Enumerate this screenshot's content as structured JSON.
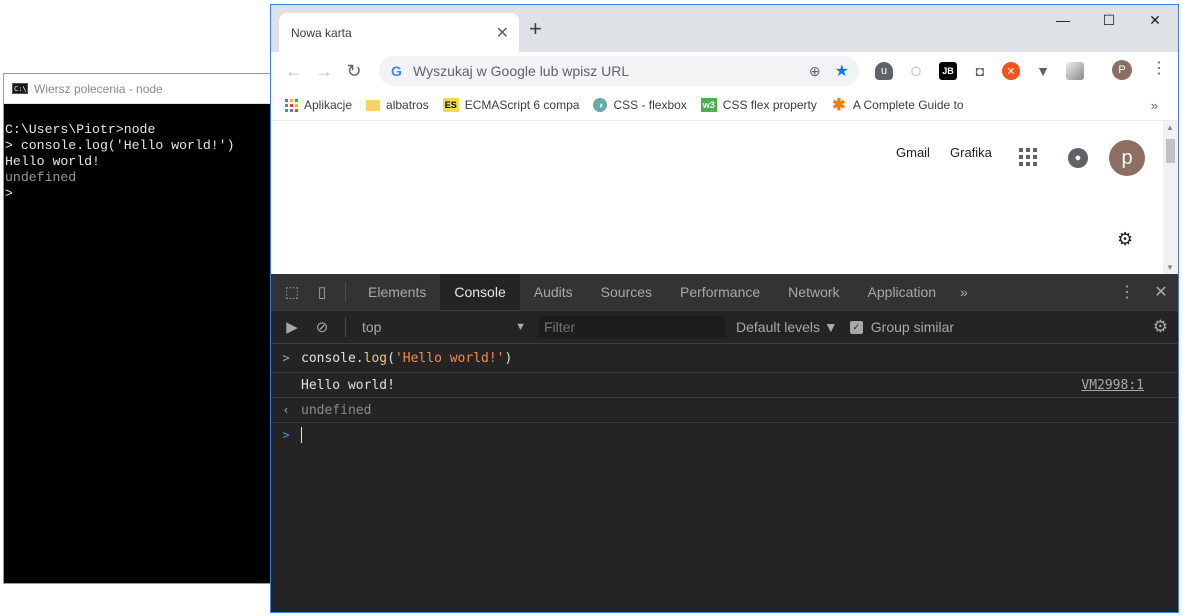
{
  "cmd": {
    "title": "Wiersz polecenia - node",
    "icon_label": "C:\\",
    "lines": [
      "C:\\Users\\Piotr>node",
      "> console.log('Hello world!')",
      "Hello world!",
      "undefined",
      ">"
    ]
  },
  "chrome": {
    "tab_title": "Nowa karta",
    "tab_close": "✕",
    "new_tab": "+",
    "window_controls": {
      "minimize": "—",
      "maximize": "☐",
      "close": "✕"
    },
    "nav": {
      "back": "←",
      "forward": "→",
      "reload": "↻"
    },
    "omnibox": {
      "g": "G",
      "placeholder": "Wyszukaj w Google lub wpisz URL",
      "zoom_icon": "⊕",
      "star_icon": "★"
    },
    "extensions": [
      "uBlock",
      "Opera",
      "JetBrains",
      "Camera",
      "Orange",
      "Vue",
      "Gray"
    ],
    "profile_letter": "P",
    "menu": "⋮",
    "bookmarks": [
      {
        "label": "Aplikacje",
        "icon": "apps-icon"
      },
      {
        "label": "albatros",
        "icon": "folder-icon"
      },
      {
        "label": "ECMAScript 6 compa",
        "icon": "es-icon"
      },
      {
        "label": "CSS - flexbox",
        "icon": "css-icon"
      },
      {
        "label": "CSS flex property",
        "icon": "w3-icon"
      },
      {
        "label": "A Complete Guide to",
        "icon": "asterisk-icon"
      }
    ],
    "bookmarks_more": "»"
  },
  "google": {
    "gmail": "Gmail",
    "images": "Grafika",
    "avatar": "p",
    "gear": "⚙"
  },
  "devtools": {
    "tabs": [
      "Elements",
      "Console",
      "Audits",
      "Sources",
      "Performance",
      "Network",
      "Application"
    ],
    "active_tab": "Console",
    "more_tabs": "»",
    "context": "top",
    "filter_placeholder": "Filter",
    "levels": "Default levels ▼",
    "group_similar": "Group similar",
    "console": {
      "input_prefix": ">",
      "input_code_obj": "console.",
      "input_code_fn": "log",
      "input_code_open": "(",
      "input_code_str": "'Hello world!'",
      "input_code_close": ")",
      "output": "Hello world!",
      "output_source": "VM2998:1",
      "result_prefix": "‹",
      "result": "undefined",
      "prompt_prefix": ">"
    }
  },
  "colors": {
    "devtools_bg": "#242424",
    "tabstrip_bg": "#dee1e6",
    "avatar_bg": "#8d6e63"
  }
}
